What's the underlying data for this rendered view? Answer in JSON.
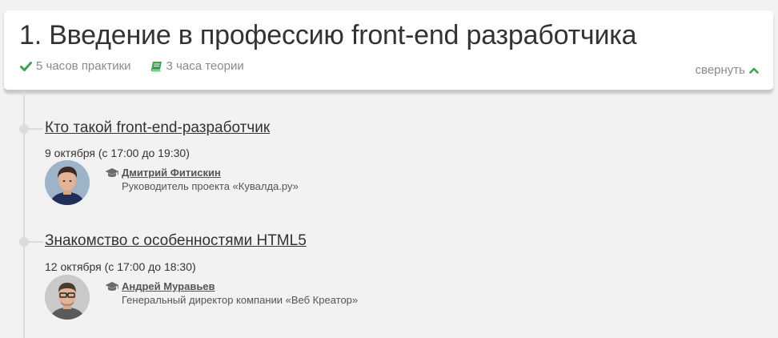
{
  "module": {
    "title": "1. Введение в профессию front-end разработчика",
    "practice_label": "5 часов практики",
    "theory_label": "3 часа теории",
    "collapse_label": "свернуть",
    "practice_icon": "checkmark-icon",
    "theory_icon": "book-icon",
    "collapse_icon": "chevron-up-icon"
  },
  "colors": {
    "accent_green": "#3aa54a",
    "text": "#333333",
    "muted": "#8b8b8b",
    "timeline": "#dcdcdc",
    "background": "#f2f2f2"
  },
  "lessons": [
    {
      "title": "Кто такой front-end-разработчик",
      "date": "9 октября (с 17:00 до 19:30)",
      "teacher": {
        "name": "Дмитрий Фитискин",
        "role": "Руководитель проекта «Кувалда.ру»",
        "icon": "graduation-cap-icon"
      }
    },
    {
      "title": "Знакомство с особенностями HTML5",
      "date": "12 октября (с 17:00 до 18:30)",
      "teacher": {
        "name": "Андрей Муравьев",
        "role": "Генеральный директор компании «Веб Креатор»",
        "icon": "graduation-cap-icon"
      }
    }
  ]
}
